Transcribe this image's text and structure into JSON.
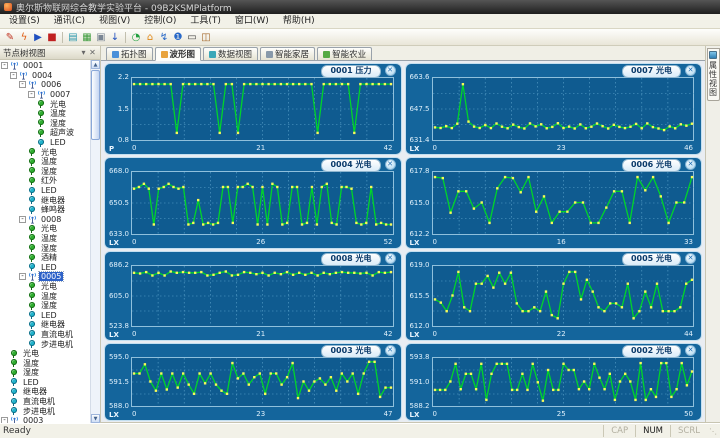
{
  "window": {
    "title": "奥尔斯物联网综合教学实验平台 - 09B2KSMPlatform"
  },
  "menu_bar": [
    "设置(S)",
    "通讯(C)",
    "视图(V)",
    "控制(O)",
    "工具(T)",
    "窗口(W)",
    "帮助(H)"
  ],
  "toolbar": {
    "icons": [
      {
        "name": "edit-pencil-icon",
        "glyph": "✎",
        "color": "#c03020"
      },
      {
        "name": "lightning-icon",
        "glyph": "ϟ",
        "color": "#e05a10"
      },
      {
        "name": "play-icon",
        "glyph": "▶",
        "color": "#2050c0"
      },
      {
        "name": "stop-icon",
        "glyph": "■",
        "color": "#c02020"
      },
      {
        "name": "separator"
      },
      {
        "name": "chart-icon",
        "glyph": "▤",
        "color": "#2a96ac"
      },
      {
        "name": "image-icon",
        "glyph": "▦",
        "color": "#3a9a3a"
      },
      {
        "name": "window-layout-icon",
        "glyph": "▣",
        "color": "#7a8694"
      },
      {
        "name": "download-arrow-icon",
        "glyph": "↓",
        "color": "#2050c0"
      },
      {
        "name": "separator"
      },
      {
        "name": "clock-icon",
        "glyph": "◔",
        "color": "#22a040"
      },
      {
        "name": "home-icon",
        "glyph": "⌂",
        "color": "#e08818"
      },
      {
        "name": "plug-icon",
        "glyph": "↯",
        "color": "#2868c8"
      },
      {
        "name": "info-icon",
        "glyph": "❶",
        "color": "#2868c8"
      },
      {
        "name": "keyboard-icon",
        "glyph": "▭",
        "color": "#444444"
      },
      {
        "name": "exit-door-icon",
        "glyph": "◫",
        "color": "#a06224"
      }
    ]
  },
  "tree_panel": {
    "title": "节点树视图",
    "items": [
      {
        "depth": 0,
        "label": "0001",
        "icon": "node",
        "exp": true
      },
      {
        "depth": 1,
        "label": "0004",
        "icon": "node",
        "exp": true
      },
      {
        "depth": 2,
        "label": "0006",
        "icon": "node",
        "exp": true
      },
      {
        "depth": 3,
        "label": "0007",
        "icon": "node",
        "exp": true
      },
      {
        "depth": 4,
        "label": "光电",
        "icon": "sensor"
      },
      {
        "depth": 4,
        "label": "温度",
        "icon": "sensor"
      },
      {
        "depth": 4,
        "label": "湿度",
        "icon": "sensor"
      },
      {
        "depth": 4,
        "label": "超声波",
        "icon": "sensor"
      },
      {
        "depth": 4,
        "label": "LED",
        "icon": "actuator"
      },
      {
        "depth": 3,
        "label": "光电",
        "icon": "sensor"
      },
      {
        "depth": 3,
        "label": "温度",
        "icon": "sensor"
      },
      {
        "depth": 3,
        "label": "湿度",
        "icon": "sensor"
      },
      {
        "depth": 3,
        "label": "红外",
        "icon": "sensor"
      },
      {
        "depth": 3,
        "label": "LED",
        "icon": "actuator"
      },
      {
        "depth": 3,
        "label": "继电器",
        "icon": "actuator"
      },
      {
        "depth": 3,
        "label": "蜂鸣器",
        "icon": "actuator"
      },
      {
        "depth": 2,
        "label": "0008",
        "icon": "node",
        "exp": true
      },
      {
        "depth": 3,
        "label": "光电",
        "icon": "sensor"
      },
      {
        "depth": 3,
        "label": "温度",
        "icon": "sensor"
      },
      {
        "depth": 3,
        "label": "湿度",
        "icon": "sensor"
      },
      {
        "depth": 3,
        "label": "酒精",
        "icon": "sensor"
      },
      {
        "depth": 3,
        "label": "LED",
        "icon": "actuator"
      },
      {
        "depth": 2,
        "label": "0005",
        "icon": "node",
        "exp": true,
        "selected": true
      },
      {
        "depth": 3,
        "label": "光电",
        "icon": "sensor"
      },
      {
        "depth": 3,
        "label": "温度",
        "icon": "sensor"
      },
      {
        "depth": 3,
        "label": "湿度",
        "icon": "sensor"
      },
      {
        "depth": 3,
        "label": "LED",
        "icon": "actuator"
      },
      {
        "depth": 3,
        "label": "继电器",
        "icon": "actuator"
      },
      {
        "depth": 3,
        "label": "直流电机",
        "icon": "actuator"
      },
      {
        "depth": 3,
        "label": "步进电机",
        "icon": "actuator"
      },
      {
        "depth": 1,
        "label": "光电",
        "icon": "sensor"
      },
      {
        "depth": 1,
        "label": "温度",
        "icon": "sensor"
      },
      {
        "depth": 1,
        "label": "湿度",
        "icon": "sensor"
      },
      {
        "depth": 1,
        "label": "LED",
        "icon": "actuator"
      },
      {
        "depth": 1,
        "label": "继电器",
        "icon": "actuator"
      },
      {
        "depth": 1,
        "label": "直流电机",
        "icon": "actuator"
      },
      {
        "depth": 1,
        "label": "步进电机",
        "icon": "actuator"
      },
      {
        "depth": 0,
        "label": "0003",
        "icon": "node",
        "exp": true
      }
    ]
  },
  "tabs": [
    {
      "name": "tab-topology",
      "label": "拓扑图",
      "icon_color": "#4a90d9",
      "active": false
    },
    {
      "name": "tab-waveform",
      "label": "波形图",
      "icon_color": "#e8a33d",
      "active": true
    },
    {
      "name": "tab-dataview",
      "label": "数据视图",
      "icon_color": "#3aa7b8",
      "active": false
    },
    {
      "name": "tab-smart-home",
      "label": "智能家居",
      "icon_color": "#8899aa",
      "active": false
    },
    {
      "name": "tab-smart-agriculture",
      "label": "智能农业",
      "icon_color": "#55aa44",
      "active": false
    }
  ],
  "side_tab": {
    "label": "属性视图"
  },
  "status_bar": {
    "left": "Ready",
    "indicators": [
      {
        "label": "CAP",
        "active": false
      },
      {
        "label": "NUM",
        "active": true
      },
      {
        "label": "SCRL",
        "active": false
      }
    ]
  },
  "colors": {
    "panel_bg": "#14659c",
    "plot_bg": "#0f5b90",
    "grid": "#5da4cb",
    "line": "#00d42a",
    "marker": "#f6f95a",
    "accent": "#2e62c8"
  },
  "chart_data": [
    {
      "type": "line",
      "title": "0001 压力",
      "unit": "P",
      "yticks": [
        "2.2",
        "1.5",
        "0.8"
      ],
      "xticks": [
        "0",
        "21",
        "42"
      ],
      "ylim": [
        0.8,
        2.2
      ],
      "values": [
        2.1,
        2.1,
        2.1,
        2.1,
        2.1,
        2.1,
        2.1,
        0.9,
        2.1,
        2.1,
        2.1,
        2.1,
        2.1,
        2.1,
        0.9,
        2.1,
        2.1,
        0.9,
        2.1,
        2.1,
        2.1,
        2.1,
        2.1,
        2.1,
        2.1,
        2.1,
        2.1,
        2.1,
        2.1,
        2.1,
        0.9,
        2.1,
        2.1,
        2.1,
        2.1,
        2.1,
        0.9,
        2.1,
        2.1,
        2.1,
        2.1,
        2.1,
        2.1
      ]
    },
    {
      "type": "line",
      "title": "0007 光电",
      "unit": "LX",
      "yticks": [
        "663.6",
        "647.5",
        "631.4"
      ],
      "xticks": [
        "0",
        "23",
        "46"
      ],
      "ylim": [
        631.4,
        663.6
      ],
      "values": [
        636.8,
        636.5,
        637.5,
        636.4,
        638.9,
        661.2,
        640.1,
        637.3,
        636.5,
        638.2,
        636.4,
        639.0,
        637.2,
        636.3,
        638.4,
        637.0,
        636.2,
        639.1,
        637.4,
        638.6,
        636.3,
        637.1,
        639.2,
        636.4,
        637.3,
        636.2,
        638.5,
        636.3,
        637.2,
        639.0,
        637.5,
        636.2,
        638.3,
        637.1,
        636.4,
        637.2,
        638.8,
        636.3,
        639.1,
        637.0,
        636.2,
        635.3,
        637.4,
        636.3,
        638.6,
        637.8,
        638.9
      ]
    },
    {
      "type": "line",
      "title": "0004 光电",
      "unit": "LX",
      "yticks": [
        "668.0",
        "650.5",
        "633.0"
      ],
      "xticks": [
        "0",
        "26",
        "52"
      ],
      "ylim": [
        633.0,
        668.0
      ],
      "values": [
        659,
        660,
        662,
        659,
        637,
        659,
        660,
        662,
        660,
        659,
        660,
        637,
        638,
        652,
        637,
        638,
        637,
        638,
        660,
        660,
        638,
        660,
        660,
        662,
        660,
        637,
        660,
        637,
        662,
        660,
        637,
        638,
        660,
        660,
        637,
        638,
        660,
        637,
        660,
        662,
        638,
        637,
        660,
        660,
        659,
        638,
        637,
        638,
        660,
        637,
        638,
        637,
        637
      ]
    },
    {
      "type": "line",
      "title": "0006 光电",
      "unit": "LX",
      "yticks": [
        "617.8",
        "615.0",
        "612.2"
      ],
      "xticks": [
        "0",
        "16",
        "33"
      ],
      "ylim": [
        612.2,
        617.8
      ],
      "values": [
        617.5,
        617.4,
        614.0,
        616.1,
        616.1,
        614.4,
        615.0,
        613.0,
        616.4,
        617.5,
        617.4,
        616.0,
        617.5,
        614.1,
        615.6,
        613.0,
        614.1,
        614.1,
        615.0,
        615.0,
        613.0,
        613.0,
        614.5,
        616.1,
        616.1,
        613.0,
        617.5,
        616.2,
        617.5,
        615.6,
        613.0,
        615.0,
        615.0,
        617.5
      ]
    },
    {
      "type": "line",
      "title": "0008 光电",
      "unit": "LX",
      "yticks": [
        "686.2",
        "605.0",
        "523.8"
      ],
      "xticks": [
        "0",
        "21",
        "42"
      ],
      "ylim": [
        523.8,
        686.2
      ],
      "values": [
        672,
        670,
        674,
        664,
        672,
        664,
        676,
        672,
        674,
        672,
        672,
        674,
        664,
        666,
        672,
        676,
        664,
        666,
        674,
        672,
        668,
        672,
        664,
        672,
        668,
        674,
        666,
        672,
        666,
        672,
        664,
        672,
        668,
        672,
        674,
        672,
        672,
        670,
        672,
        664,
        674,
        672,
        674
      ]
    },
    {
      "type": "line",
      "title": "0005 光电",
      "unit": "LX",
      "yticks": [
        "619.0",
        "615.5",
        "612.0"
      ],
      "xticks": [
        "0",
        "22",
        "44"
      ],
      "ylim": [
        612.0,
        619.0
      ],
      "values": [
        615.0,
        614.6,
        613.5,
        615.5,
        618.5,
        614.0,
        613.5,
        617.0,
        617.0,
        618.0,
        616.5,
        618.4,
        617.0,
        618.4,
        614.5,
        613.5,
        613.5,
        614.0,
        613.5,
        616.0,
        613.0,
        612.6,
        617.0,
        618.5,
        618.5,
        615.0,
        617.5,
        616.0,
        614.0,
        613.5,
        614.5,
        614.5,
        614.0,
        617.0,
        612.6,
        613.5,
        616.0,
        614.0,
        617.0,
        613.5,
        613.5,
        613.5,
        614.0,
        617.0,
        617.5
      ]
    },
    {
      "type": "line",
      "title": "0003 光电",
      "unit": "LX",
      "yticks": [
        "595.0",
        "591.5",
        "588.0"
      ],
      "xticks": [
        "0",
        "23",
        "47"
      ],
      "ylim": [
        588.0,
        595.0
      ],
      "values": [
        592.8,
        592.8,
        594.3,
        591.5,
        590.0,
        592.8,
        590.2,
        592.8,
        590.5,
        592.8,
        591.0,
        589.5,
        592.8,
        591.2,
        592.8,
        591.0,
        590.0,
        589.5,
        594.5,
        592.0,
        592.8,
        591.0,
        592.2,
        592.8,
        589.5,
        592.8,
        592.8,
        591.0,
        592.2,
        594.5,
        588.8,
        591.5,
        590.0,
        591.5,
        592.0,
        591.0,
        592.2,
        590.0,
        592.8,
        591.5,
        592.8,
        589.5,
        592.8,
        594.7,
        594.7,
        589.0,
        590.5,
        590.5
      ]
    },
    {
      "type": "line",
      "title": "0002 光电",
      "unit": "LX",
      "yticks": [
        "593.8",
        "591.0",
        "588.2"
      ],
      "xticks": [
        "0",
        "25",
        "50"
      ],
      "ylim": [
        588.2,
        593.8
      ],
      "values": [
        589.9,
        589.9,
        589.9,
        591.0,
        593.3,
        590.0,
        592.0,
        592.0,
        590.0,
        593.3,
        588.6,
        592.0,
        593.3,
        593.3,
        593.3,
        589.9,
        589.9,
        592.0,
        589.9,
        593.3,
        590.9,
        588.5,
        592.5,
        589.9,
        589.9,
        593.3,
        592.5,
        592.5,
        590.0,
        591.0,
        590.0,
        593.3,
        591.5,
        590.0,
        592.0,
        588.6,
        591.0,
        592.0,
        591.0,
        588.6,
        593.4,
        588.6,
        590.0,
        589.0,
        593.4,
        593.4,
        589.0,
        590.0,
        593.4,
        590.5,
        592.3
      ]
    }
  ]
}
